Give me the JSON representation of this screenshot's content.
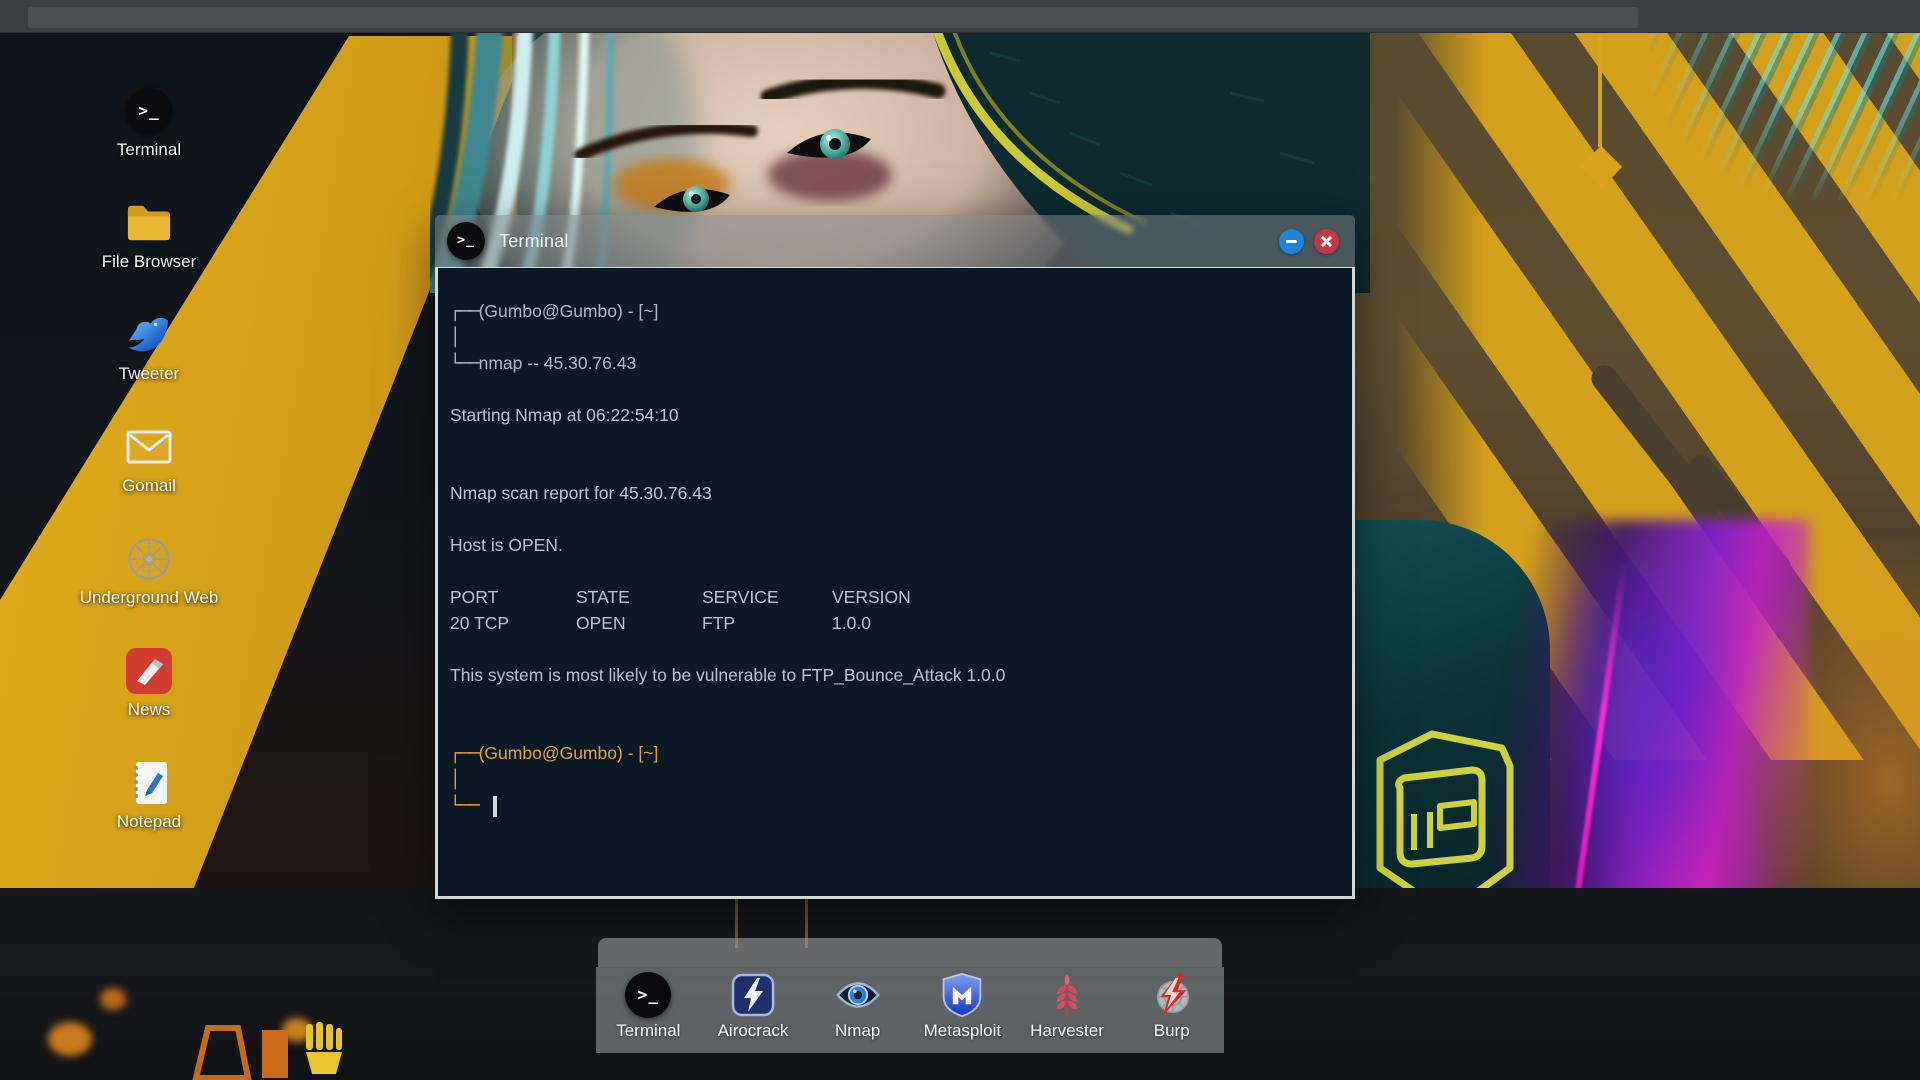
{
  "topbar": {},
  "desktop": {
    "icons": [
      {
        "icon": "terminal-icon",
        "label": "Terminal"
      },
      {
        "icon": "folder-icon",
        "label": "File Browser"
      },
      {
        "icon": "bird-icon",
        "label": "Tweeter"
      },
      {
        "icon": "mail-icon",
        "label": "Gomail"
      },
      {
        "icon": "web-icon",
        "label": "Underground Web"
      },
      {
        "icon": "news-icon",
        "label": "News"
      },
      {
        "icon": "notepad-icon",
        "label": "Notepad"
      }
    ]
  },
  "window": {
    "title": "Terminal",
    "icon": "terminal-icon",
    "controls": {
      "minimize": "minimize-button",
      "close": "close-button"
    },
    "colors": {
      "terminal_background": "#0d1826",
      "terminal_text": "#b9c4d3",
      "prompt_orange": "#e0a339",
      "minimize_blue": "#1e86d9",
      "close_red": "#c03a46"
    }
  },
  "terminal": {
    "glyphs": {
      "corner_top": "┌──",
      "pipe": "│",
      "corner_bottom": "└──"
    },
    "lines": [
      {
        "kind": "prompt_open",
        "tone": "gray",
        "text": "(Gumbo@Gumbo) - [~]"
      },
      {
        "kind": "prompt_pipe",
        "tone": "gray"
      },
      {
        "kind": "prompt_close",
        "tone": "gray",
        "text": "nmap -- 45.30.76.43"
      },
      {
        "kind": "blank"
      },
      {
        "kind": "text",
        "text": "Starting Nmap at 06:22:54:10"
      },
      {
        "kind": "blank"
      },
      {
        "kind": "blank"
      },
      {
        "kind": "text",
        "text": "Nmap scan report for 45.30.76.43"
      },
      {
        "kind": "blank"
      },
      {
        "kind": "text",
        "text": "Host is OPEN."
      },
      {
        "kind": "blank"
      },
      {
        "kind": "row",
        "cells": [
          "PORT",
          "STATE",
          "SERVICE",
          "VERSION"
        ]
      },
      {
        "kind": "row",
        "cells": [
          "20 TCP",
          "OPEN",
          "FTP",
          "1.0.0"
        ]
      },
      {
        "kind": "blank"
      },
      {
        "kind": "text",
        "text": "This system is most likely to be vulnerable to FTP_Bounce_Attack 1.0.0"
      },
      {
        "kind": "blank"
      },
      {
        "kind": "blank"
      },
      {
        "kind": "prompt_open",
        "tone": "orange",
        "text": "(Gumbo@Gumbo) - [~]"
      },
      {
        "kind": "prompt_pipe",
        "tone": "orange"
      },
      {
        "kind": "prompt_close",
        "tone": "orange",
        "text": "",
        "cursor": true
      }
    ]
  },
  "dock": {
    "items": [
      {
        "icon": "terminal-icon",
        "label": "Terminal"
      },
      {
        "icon": "airocrack-icon",
        "label": "Airocrack"
      },
      {
        "icon": "nmap-icon",
        "label": "Nmap"
      },
      {
        "icon": "metasploit-icon",
        "label": "Metasploit"
      },
      {
        "icon": "harvester-icon",
        "label": "Harvester"
      },
      {
        "icon": "burp-icon",
        "label": "Burp"
      }
    ]
  }
}
